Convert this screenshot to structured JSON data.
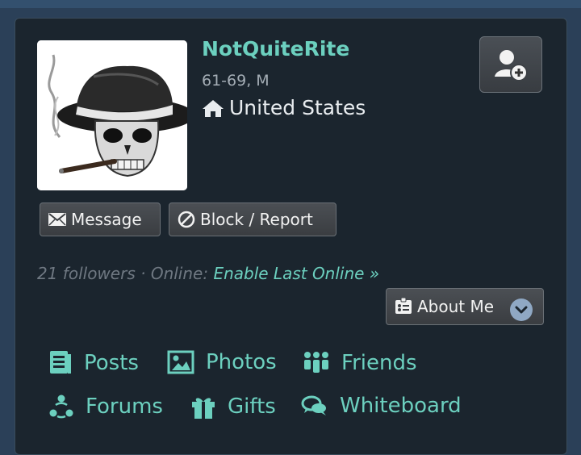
{
  "profile": {
    "username": "NotQuiteRite",
    "age_gender": "61-69, M",
    "location": "United States"
  },
  "actions": {
    "message_label": "Message",
    "block_label": "Block / Report",
    "about_label": "About Me"
  },
  "status": {
    "followers": "21 followers",
    "separator": " · ",
    "online_label": "Online:",
    "enable_link": "Enable Last Online »"
  },
  "nav": {
    "posts": "Posts",
    "photos": "Photos",
    "friends": "Friends",
    "forums": "Forums",
    "gifts": "Gifts",
    "whiteboard": "Whiteboard"
  },
  "colors": {
    "accent": "#6cd0bf",
    "panel": "#1b252e",
    "background": "#2b4058"
  }
}
